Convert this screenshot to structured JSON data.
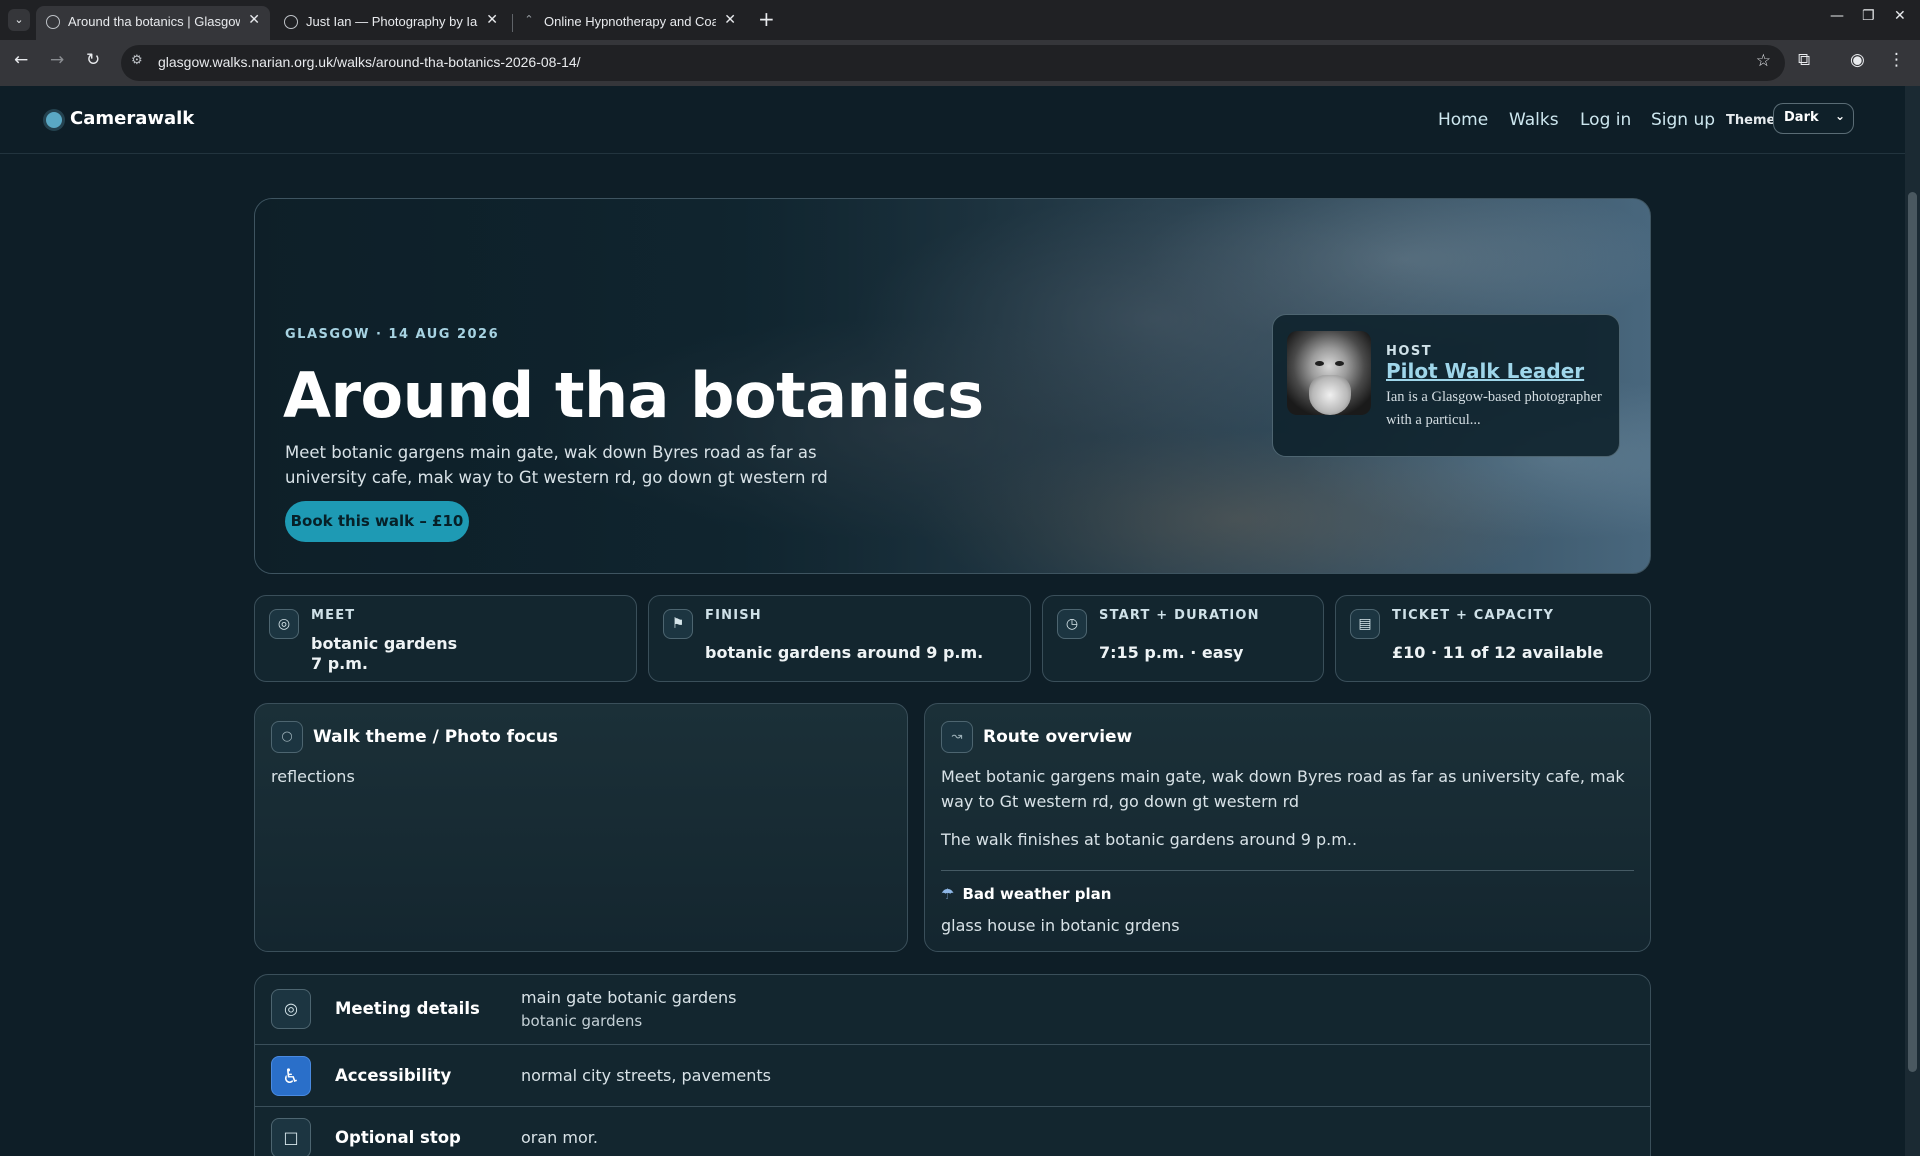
{
  "browser": {
    "tabs": [
      {
        "title": "Around tha botanics | Glasgow"
      },
      {
        "title": "Just Ian — Photography by Ian"
      },
      {
        "title": "Online Hypnotherapy and Coaching"
      }
    ],
    "url": "glasgow.walks.narian.org.uk/walks/around-tha-botanics-2026-08-14/"
  },
  "site": {
    "brand": "Camerawalk",
    "nav": [
      "Home",
      "Walks",
      "Log in",
      "Sign up"
    ],
    "theme_label": "Theme",
    "theme_value": "Dark"
  },
  "hero": {
    "kicker": "GLASGOW · 14 AUG 2026",
    "title": "Around tha botanics",
    "description": "Meet botanic gargens main gate, wak down Byres road as far as university cafe, mak way to Gt western rd, go down gt western rd",
    "book_label": "Book this walk – £10",
    "host": {
      "kicker": "HOST",
      "name": "Pilot Walk Leader",
      "bio": "Ian is a Glasgow-based photographer with a particul..."
    }
  },
  "stats": [
    {
      "icon": "target-icon",
      "label": "MEET",
      "line1": "botanic gardens",
      "line2": "7 p.m."
    },
    {
      "icon": "flag-icon",
      "label": "FINISH",
      "value": "botanic gardens around 9 p.m."
    },
    {
      "icon": "clock-icon",
      "label": "START + DURATION",
      "value": "7:15 p.m. · easy"
    },
    {
      "icon": "ticket-icon",
      "label": "TICKET + CAPACITY",
      "value": "£10 · 11 of 12 available"
    }
  ],
  "theme_panel": {
    "title": "Walk theme / Photo focus",
    "text": "reflections"
  },
  "route_panel": {
    "title": "Route overview",
    "text": "Meet botanic gargens main gate, wak down Byres road as far as university cafe, mak way to Gt western rd, go down gt western rd",
    "finish_text": "The walk finishes at botanic gardens around 9 p.m..",
    "weather_title": "Bad weather plan",
    "weather_text": "glass house in botanic grdens"
  },
  "details": [
    {
      "label": "Meeting details",
      "value": "main gate botanic gardens",
      "sub": "botanic gardens"
    },
    {
      "label": "Accessibility",
      "value": "normal city streets, pavements"
    },
    {
      "label": "Optional stop",
      "value": "oran mor."
    }
  ],
  "colors": {
    "accent": "#1e9ab4",
    "background": "#0e1e27",
    "card": "#13262f",
    "link": "#9fd6ea"
  }
}
